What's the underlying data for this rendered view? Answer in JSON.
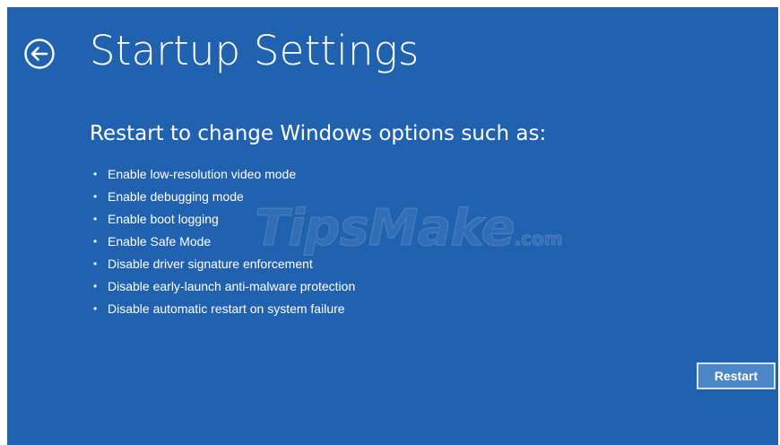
{
  "colors": {
    "background": "#2162b0",
    "button_background": "#4b86c6",
    "button_border": "#d4e3f4",
    "text": "#ffffff"
  },
  "header": {
    "back_icon": "arrow-left-circle-icon",
    "title": "Startup Settings"
  },
  "main": {
    "subtitle": "Restart to change Windows options such as:",
    "bullet_glyph": "•",
    "options": [
      "Enable low-resolution video mode",
      "Enable debugging mode",
      "Enable boot logging",
      "Enable Safe Mode",
      "Disable driver signature enforcement",
      "Disable early-launch anti-malware protection",
      "Disable automatic restart on system failure"
    ]
  },
  "watermark": {
    "text": "TipsMake",
    "suffix": ".com"
  },
  "footer": {
    "restart_label": "Restart"
  }
}
